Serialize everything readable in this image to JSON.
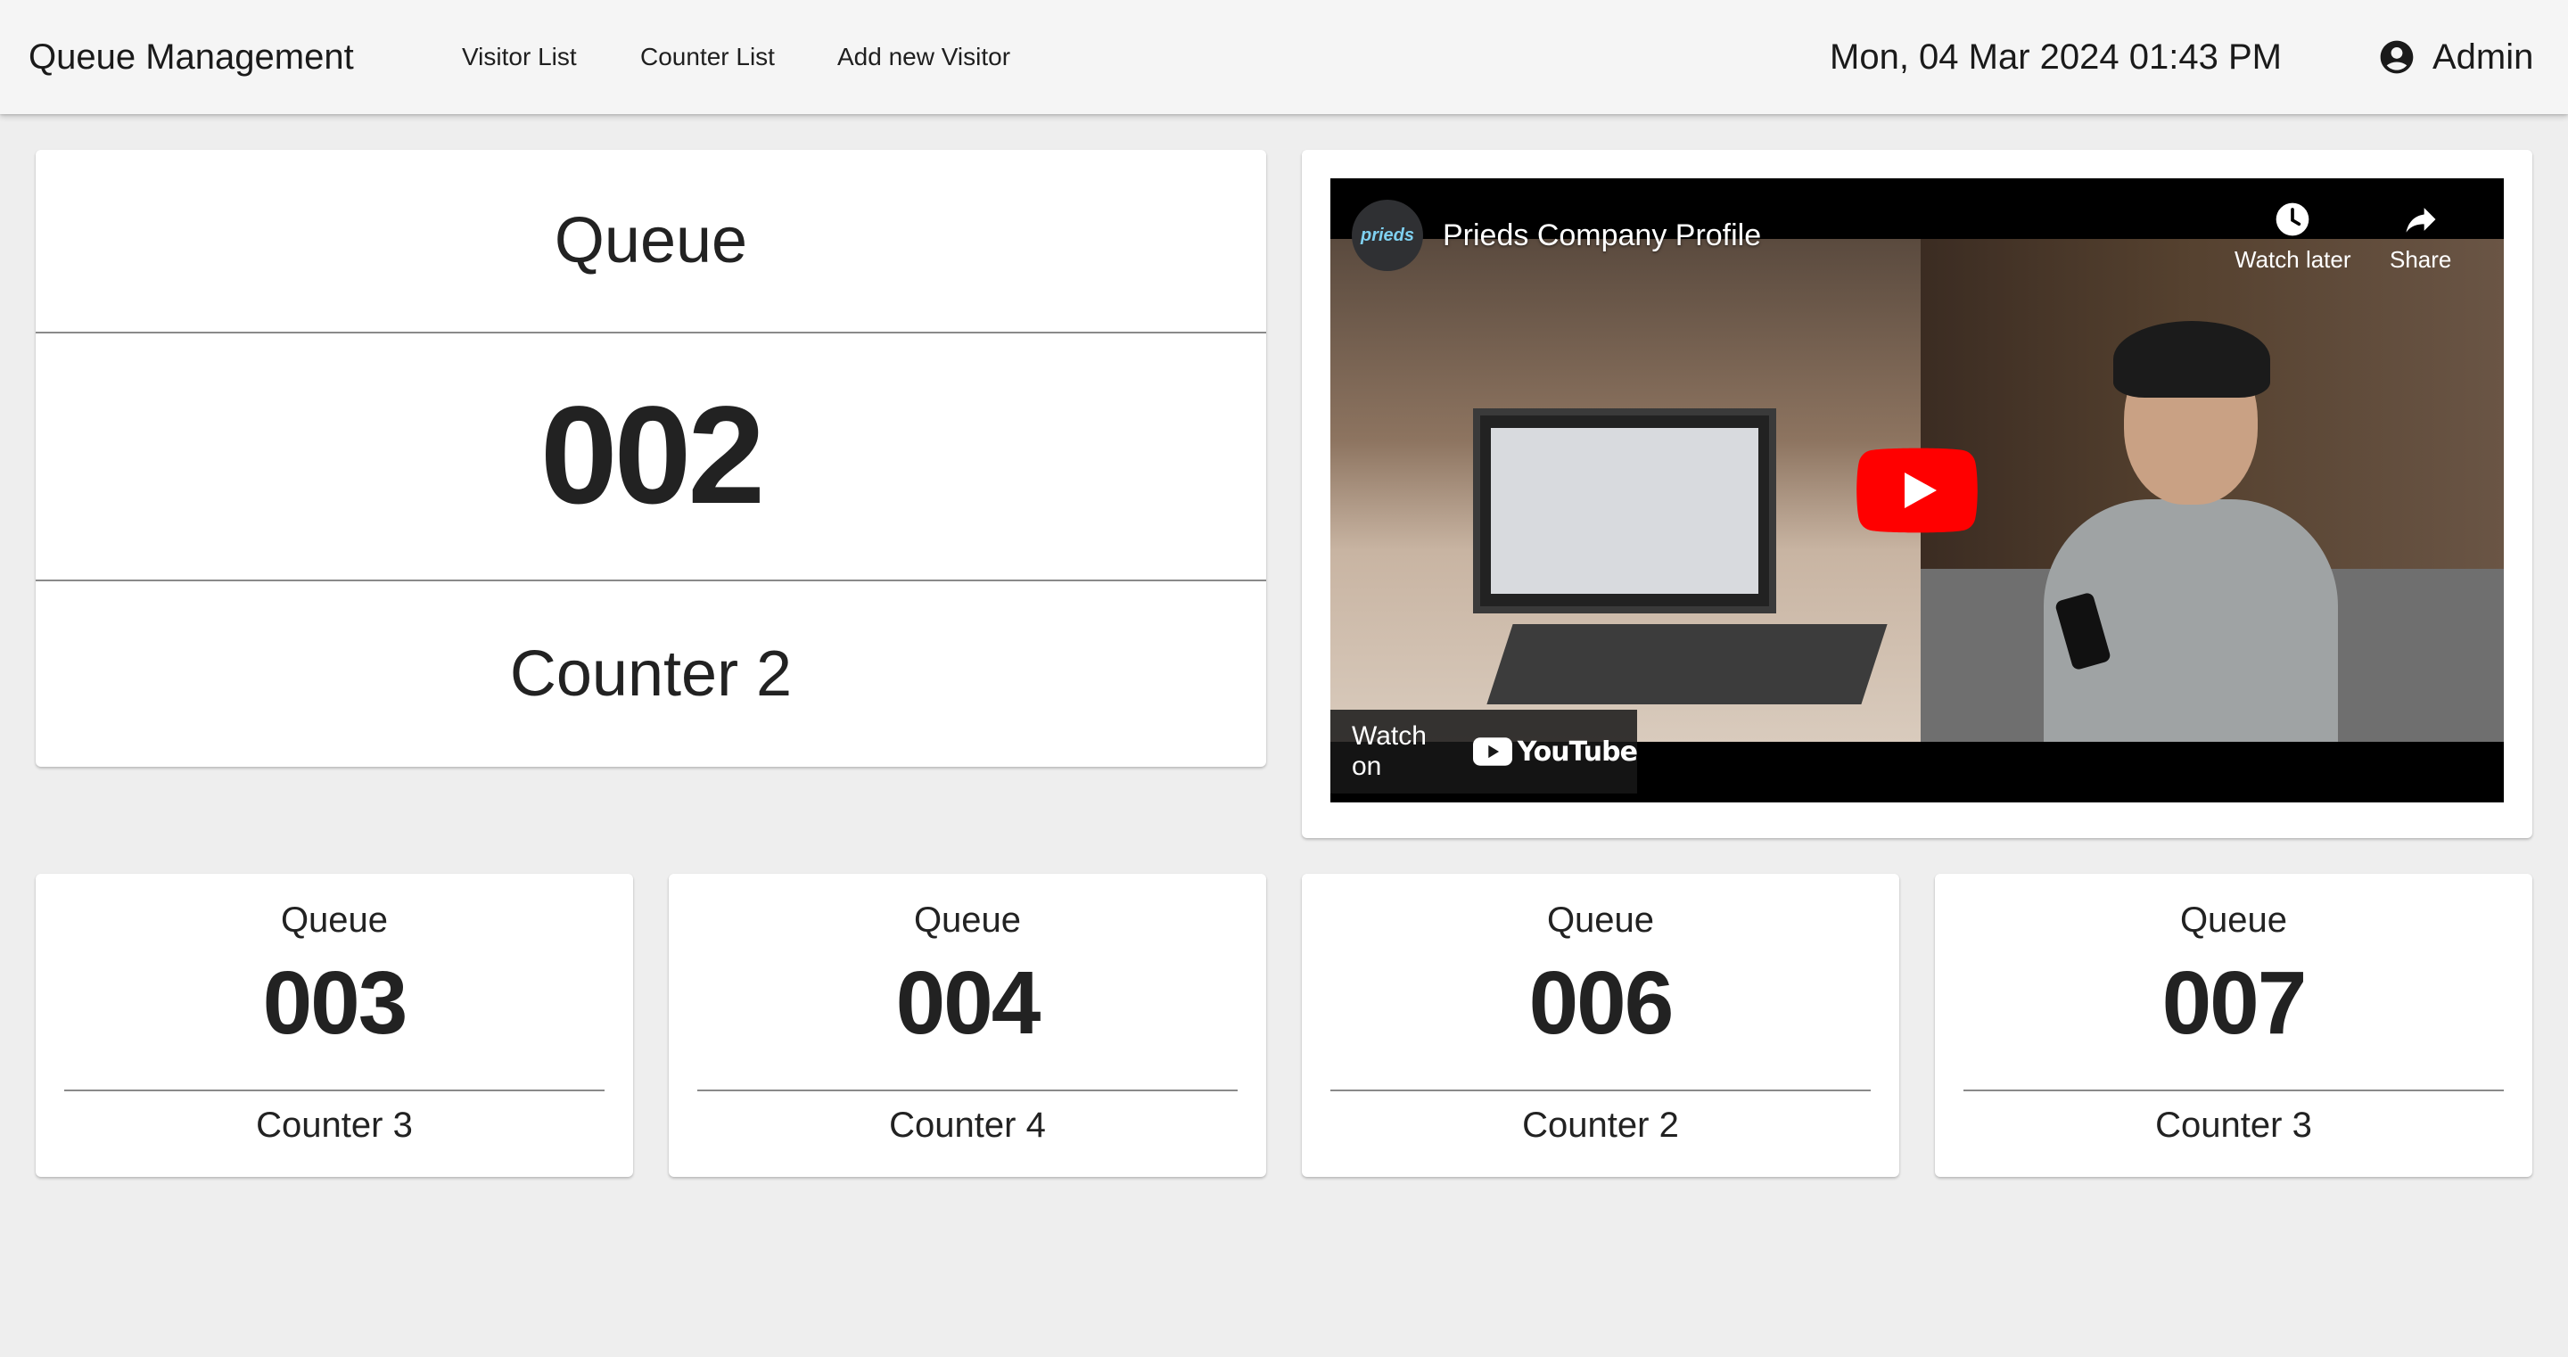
{
  "app": {
    "title": "Queue Management"
  },
  "nav": {
    "items": [
      "Visitor List",
      "Counter List",
      "Add new Visitor"
    ]
  },
  "header": {
    "datetime": "Mon, 04 Mar 2024 01:43 PM",
    "user": "Admin"
  },
  "current": {
    "label": "Queue",
    "number": "002",
    "counter": "Counter 2"
  },
  "video": {
    "channel_logo_text": "prieds",
    "title": "Prieds Company Profile",
    "watch_later": "Watch later",
    "share": "Share",
    "watch_on": "Watch on",
    "youtube": "YouTube",
    "play_color": "#ff0000"
  },
  "queues": [
    {
      "label": "Queue",
      "number": "003",
      "counter": "Counter 3"
    },
    {
      "label": "Queue",
      "number": "004",
      "counter": "Counter 4"
    },
    {
      "label": "Queue",
      "number": "006",
      "counter": "Counter 2"
    },
    {
      "label": "Queue",
      "number": "007",
      "counter": "Counter 3"
    }
  ],
  "icons": {
    "user": "account-circle-icon",
    "watch_later": "clock-icon",
    "share": "share-arrow-icon",
    "play": "play-button-icon"
  }
}
